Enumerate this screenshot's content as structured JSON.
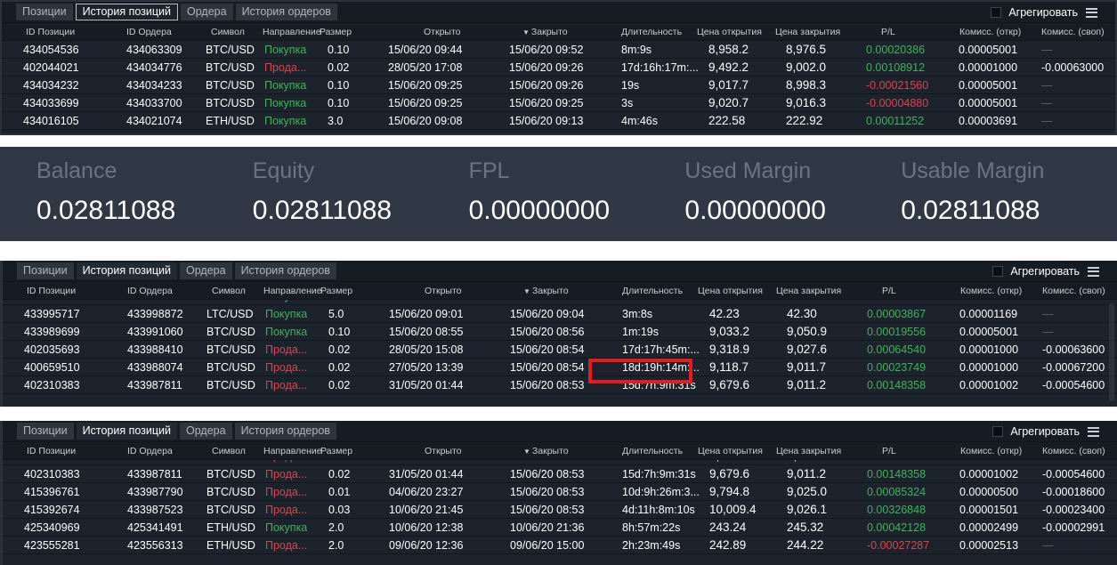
{
  "tabs": [
    "Позиции",
    "История позиций",
    "Ордера",
    "История ордеров"
  ],
  "active_tab": 1,
  "aggregate_label": "Агрегировать",
  "columns": [
    "ID Позиции",
    "ID Ордера",
    "Символ",
    "Направление",
    "Размер",
    "Открыто",
    "Закрыто",
    "Длительность",
    "Цена открытия",
    "Цена закрытия",
    "P/L",
    "Комисс. (откр)",
    "Комисс. (своп)"
  ],
  "sorted_column": 6,
  "colors": {
    "buy": "#3fb25a",
    "sell": "#d9444f",
    "background": "#1c232c",
    "card_background": "#303845",
    "highlight": "#e31d1d"
  },
  "panel1": {
    "rows": [
      [
        "434054536",
        "434063309",
        "BTC/USD",
        "Покупка",
        "0.10",
        "15/06/20 09:44",
        "15/06/20 09:52",
        "8m:9s",
        "8,958.2",
        "8,976.5",
        "0.00020386",
        "0.00005001",
        "—"
      ],
      [
        "402044021",
        "434034776",
        "BTC/USD",
        "Прода...",
        "0.02",
        "28/05/20 17:08",
        "15/06/20 09:26",
        "17d:16h:17m:...",
        "9,492.2",
        "9,002.0",
        "0.00108912",
        "0.00001000",
        "-0.00063000"
      ],
      [
        "434034232",
        "434034233",
        "BTC/USD",
        "Покупка",
        "0.10",
        "15/06/20 09:25",
        "15/06/20 09:26",
        "19s",
        "9,017.7",
        "8,998.3",
        "-0.00021560",
        "0.00005001",
        "—"
      ],
      [
        "434033699",
        "434033700",
        "BTC/USD",
        "Покупка",
        "0.10",
        "15/06/20 09:25",
        "15/06/20 09:25",
        "3s",
        "9,020.7",
        "9,016.3",
        "-0.00004880",
        "0.00005001",
        "—"
      ],
      [
        "434016105",
        "434021074",
        "ETH/USD",
        "Покупка",
        "3.0",
        "15/06/20 09:08",
        "15/06/20 09:13",
        "4m:46s",
        "222.58",
        "222.92",
        "0.00011252",
        "0.00003691",
        "—"
      ]
    ]
  },
  "cards": [
    {
      "label": "Balance",
      "value": "0.02811088"
    },
    {
      "label": "Equity",
      "value": "0.02811088"
    },
    {
      "label": "FPL",
      "value": "0.00000000"
    },
    {
      "label": "Used Margin",
      "value": "0.00000000"
    },
    {
      "label": "Usable Margin",
      "value": "0.02811088"
    }
  ],
  "panel2": {
    "rows": [
      [
        "433995717",
        "433998872",
        "LTC/USD",
        "Покупка",
        "5.0",
        "15/06/20 09:01",
        "15/06/20 09:04",
        "3m:8s",
        "42.23",
        "42.30",
        "0.00003867",
        "0.00001169",
        "—"
      ],
      [
        "433989699",
        "433991060",
        "BTC/USD",
        "Покупка",
        "0.10",
        "15/06/20 08:55",
        "15/06/20 08:56",
        "1m:19s",
        "9,033.2",
        "9,050.9",
        "0.00019556",
        "0.00005001",
        "—"
      ],
      [
        "402035693",
        "433988410",
        "BTC/USD",
        "Прода...",
        "0.02",
        "28/05/20 15:08",
        "15/06/20 08:54",
        "17d:17h:45m:...",
        "9,318.9",
        "9,027.6",
        "0.00064540",
        "0.00001000",
        "-0.00063600"
      ],
      [
        "400659510",
        "433988074",
        "BTC/USD",
        "Прода...",
        "0.02",
        "27/05/20 13:39",
        "15/06/20 08:54",
        "18d:19h:14m:...",
        "9,118.7",
        "9,011.7",
        "0.00023749",
        "0.00001000",
        "-0.00067200"
      ],
      [
        "402310383",
        "433987811",
        "BTC/USD",
        "Прода...",
        "0.02",
        "31/05/20 01:44",
        "15/06/20 08:53",
        "15d:7h:9m:31s",
        "9,679.6",
        "9,011.2",
        "0.00148358",
        "0.00001002",
        "-0.00054600"
      ]
    ]
  },
  "panel3": {
    "rows": [
      [
        "402310383",
        "433987811",
        "BTC/USD",
        "Прода...",
        "0.02",
        "31/05/20 01:44",
        "15/06/20 08:53",
        "15d:7h:9m:31s",
        "9,679.6",
        "9,011.2",
        "0.00148358",
        "0.00001002",
        "-0.00054600"
      ],
      [
        "415396761",
        "433987790",
        "BTC/USD",
        "Прода...",
        "0.01",
        "04/06/20 23:27",
        "15/06/20 08:53",
        "10d:9h:26m:3...",
        "9,794.8",
        "9,025.0",
        "0.00085324",
        "0.00000500",
        "-0.00018600"
      ],
      [
        "415392674",
        "433987523",
        "BTC/USD",
        "Прода...",
        "0.03",
        "10/06/20 21:45",
        "15/06/20 08:53",
        "4d:11h:8m:10s",
        "10,009.4",
        "9,026.1",
        "0.00326848",
        "0.00001501",
        "-0.00023400"
      ],
      [
        "425340969",
        "425341491",
        "ETH/USD",
        "Покупка",
        "2.0",
        "10/06/20 12:38",
        "10/06/20 21:36",
        "8h:57m:22s",
        "243.24",
        "245.32",
        "0.00042128",
        "0.00002499",
        "-0.00002991"
      ],
      [
        "423555281",
        "423556313",
        "ETH/USD",
        "Прода...",
        "2.0",
        "09/06/20 12:36",
        "09/06/20 15:00",
        "2h:23m:49s",
        "242.89",
        "244.22",
        "-0.00027287",
        "0.00002513",
        "—"
      ]
    ]
  }
}
